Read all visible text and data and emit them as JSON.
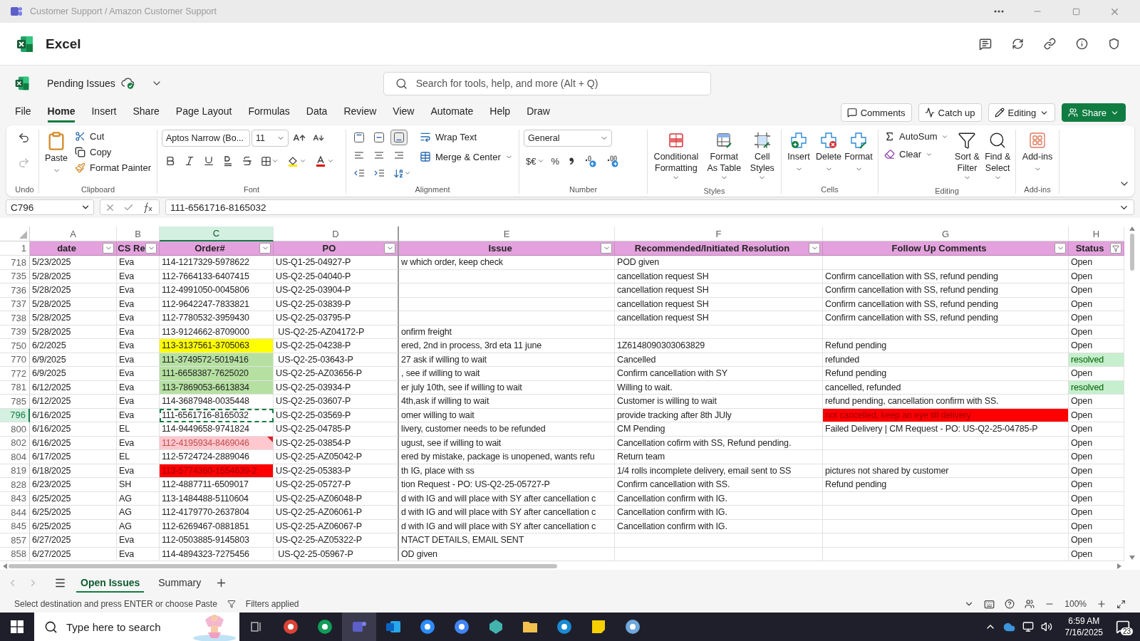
{
  "window": {
    "title": "Customer Support / Amazon Customer Support"
  },
  "app": {
    "name": "Excel"
  },
  "document": {
    "name": "Pending Issues"
  },
  "search": {
    "placeholder": "Search for tools, help, and more (Alt + Q)"
  },
  "menu_tabs": [
    {
      "label": "File",
      "selected": false
    },
    {
      "label": "Home",
      "selected": true
    },
    {
      "label": "Insert",
      "selected": false
    },
    {
      "label": "Share",
      "selected": false
    },
    {
      "label": "Page Layout",
      "selected": false
    },
    {
      "label": "Formulas",
      "selected": false
    },
    {
      "label": "Data",
      "selected": false
    },
    {
      "label": "Review",
      "selected": false
    },
    {
      "label": "View",
      "selected": false
    },
    {
      "label": "Automate",
      "selected": false
    },
    {
      "label": "Help",
      "selected": false
    },
    {
      "label": "Draw",
      "selected": false
    }
  ],
  "actions": [
    {
      "label": "Comments",
      "kind": "comments"
    },
    {
      "label": "Catch up",
      "kind": "catchup"
    },
    {
      "label": "Editing",
      "kind": "mode"
    },
    {
      "label": "Share",
      "kind": "share"
    }
  ],
  "ribbon": {
    "groups": [
      {
        "kind": "undo",
        "label": "Undo"
      },
      {
        "kind": "clipboard",
        "label": "Clipboard",
        "buttons": [
          "Paste",
          "Cut",
          "Copy",
          "Format Painter"
        ]
      },
      {
        "kind": "font",
        "label": "Font",
        "font": "Aptos Narrow (Bo...",
        "size": "11"
      },
      {
        "kind": "alignment",
        "label": "Alignment",
        "buttons": [
          "Wrap Text",
          "Merge & Center"
        ],
        "vertical": [
          {
            "selected": false
          },
          {
            "selected": false
          },
          {
            "selected": true
          }
        ]
      },
      {
        "kind": "number",
        "label": "Number",
        "format": "General",
        "currency": "$€",
        "percent": "%"
      },
      {
        "kind": "styles",
        "label": "Styles",
        "buttons": [
          "Conditional Formatting",
          "Format As Table",
          "Cell Styles"
        ]
      },
      {
        "kind": "cells",
        "label": "Cells",
        "buttons": [
          "Insert",
          "Delete",
          "Format"
        ]
      },
      {
        "kind": "editing",
        "label": "Editing",
        "buttons": [
          "AutoSum",
          "Clear",
          "Sort & Filter",
          "Find & Select"
        ]
      },
      {
        "kind": "addins",
        "label": "Add-ins",
        "buttons": [
          "Add-ins"
        ]
      }
    ]
  },
  "formula_bar": {
    "cell": "C796",
    "value": "111-6561716-8165032"
  },
  "columns": [
    {
      "letter": "A",
      "selected": false
    },
    {
      "letter": "B",
      "selected": false
    },
    {
      "letter": "C",
      "selected": true
    },
    {
      "letter": "D",
      "selected": false
    },
    {
      "letter": "E",
      "selected": false
    },
    {
      "letter": "F",
      "selected": false
    },
    {
      "letter": "G",
      "selected": false
    },
    {
      "letter": "H",
      "selected": false
    }
  ],
  "header_row": {
    "number": "1",
    "cells": [
      {
        "text": "date",
        "filtered": false
      },
      {
        "text": "CS Re",
        "filtered": false
      },
      {
        "text": "Order#",
        "filtered": false
      },
      {
        "text": "PO",
        "filtered": false
      },
      {
        "text": "Issue",
        "filtered": false
      },
      {
        "text": "Recommended/Initiated Resolution",
        "filtered": false
      },
      {
        "text": "Follow Up Comments",
        "filtered": false
      },
      {
        "text": "Status",
        "filtered": true
      }
    ]
  },
  "rows": [
    {
      "number": "718",
      "cells": [
        {
          "text": "5/23/2025"
        },
        {
          "text": "Eva"
        },
        {
          "text": "114-1217329-5978622"
        },
        {
          "text": "US-Q1-25-04927-P"
        },
        {
          "text": "w which order, keep check"
        },
        {
          "text": "POD given"
        },
        {},
        {
          "text": "Open"
        }
      ]
    },
    {
      "number": "735",
      "cells": [
        {
          "text": "5/28/2025"
        },
        {
          "text": "Eva"
        },
        {
          "text": "112-7664133-6407415"
        },
        {
          "text": "US-Q2-25-04040-P"
        },
        {},
        {
          "text": "cancellation request SH"
        },
        {
          "text": "Confirm cancellation with SS, refund pending"
        },
        {
          "text": "Open"
        }
      ]
    },
    {
      "number": "736",
      "cells": [
        {
          "text": "5/28/2025"
        },
        {
          "text": "Eva"
        },
        {
          "text": "112-4991050-0045806"
        },
        {
          "text": "US-Q2-25-03904-P"
        },
        {},
        {
          "text": "cancellation request SH"
        },
        {
          "text": "Confirm cancellation with SS, refund pending"
        },
        {
          "text": "Open"
        }
      ]
    },
    {
      "number": "737",
      "cells": [
        {
          "text": "5/28/2025"
        },
        {
          "text": "Eva"
        },
        {
          "text": "112-9642247-7833821"
        },
        {
          "text": "US-Q2-25-03839-P"
        },
        {},
        {
          "text": "cancellation request SH"
        },
        {
          "text": "Confirm cancellation with SS, refund pending"
        },
        {
          "text": "Open"
        }
      ]
    },
    {
      "number": "738",
      "cells": [
        {
          "text": "5/28/2025"
        },
        {
          "text": "Eva"
        },
        {
          "text": "112-7780532-3959430"
        },
        {
          "text": "US-Q2-25-03795-P"
        },
        {},
        {
          "text": "cancellation request SH"
        },
        {
          "text": "Confirm cancellation with SS, refund pending"
        },
        {
          "text": "Open"
        }
      ]
    },
    {
      "number": "739",
      "cells": [
        {
          "text": "5/28/2025"
        },
        {
          "text": "Eva"
        },
        {
          "text": "113-9124662-8709000"
        },
        {
          "text": " US-Q2-25-AZ04172-P"
        },
        {
          "text": "onfirm freight"
        },
        {},
        {},
        {
          "text": "Open"
        }
      ]
    },
    {
      "number": "750",
      "cells": [
        {
          "text": "6/2/2025"
        },
        {
          "text": "Eva"
        },
        {
          "text": "113-3137561-3705063",
          "color": "#ffff00"
        },
        {
          "text": "US-Q2-25-04238-P"
        },
        {
          "text": "ered, 2nd in process, 3rd eta 11 june"
        },
        {
          "text": "1Z6148090303063829"
        },
        {
          "text": "Refund pending"
        },
        {
          "text": "Open"
        }
      ]
    },
    {
      "number": "770",
      "cells": [
        {
          "text": "6/9/2025"
        },
        {
          "text": "Eva"
        },
        {
          "text": "111-3749572-5019416",
          "color": "#b5e0a1"
        },
        {
          "text": " US-Q2-25-03643-P"
        },
        {
          "text": "27 ask if willing to wait"
        },
        {
          "text": "Cancelled"
        },
        {
          "text": "refunded"
        },
        {
          "text": "resolved",
          "color": "#c6efce",
          "kind": "good"
        }
      ]
    },
    {
      "number": "772",
      "cells": [
        {
          "text": "6/9/2025"
        },
        {
          "text": "Eva"
        },
        {
          "text": "111-6658387-7625020",
          "color": "#b5e0a1"
        },
        {
          "text": "US-Q2-25-AZ03656-P"
        },
        {
          "text": ", see if willing to wait"
        },
        {
          "text": "Confirm cancellation with SY"
        },
        {
          "text": "Refund pending"
        },
        {
          "text": "Open"
        }
      ]
    },
    {
      "number": "781",
      "cells": [
        {
          "text": "6/12/2025"
        },
        {
          "text": "Eva"
        },
        {
          "text": "113-7869053-6613834",
          "color": "#b5e0a1"
        },
        {
          "text": "US-Q2-25-03934-P"
        },
        {
          "text": "er july 10th, see if willing to wait"
        },
        {
          "text": "Willing to wait."
        },
        {
          "text": "cancelled, refunded"
        },
        {
          "text": "resolved",
          "color": "#c6efce",
          "kind": "good"
        }
      ]
    },
    {
      "number": "785",
      "cells": [
        {
          "text": "6/12/2025"
        },
        {
          "text": "Eva"
        },
        {
          "text": "114-3687948-0035448"
        },
        {
          "text": "US-Q2-25-03607-P"
        },
        {
          "text": "4th,ask if willing to wait"
        },
        {
          "text": "Customer is willing to wait"
        },
        {
          "text": "refund pending, cancellation confirm with SS."
        },
        {
          "text": "Open"
        }
      ]
    },
    {
      "number": "796",
      "cells": [
        {
          "text": "6/16/2025"
        },
        {
          "text": "Eva"
        },
        {
          "text": "111-6561716-8165032",
          "selected": true
        },
        {
          "text": "US-Q2-25-03569-P"
        },
        {
          "text": "omer willing to wait"
        },
        {
          "text": "provide tracking after 8th JUly"
        },
        {
          "text": "not cancelled, keep an eye till delivery",
          "color": "#ff0000",
          "kind": "alert"
        },
        {
          "text": "Open"
        }
      ]
    },
    {
      "number": "800",
      "cells": [
        {
          "text": "6/16/2025"
        },
        {
          "text": "EL"
        },
        {
          "text": "114-9449658-9741824"
        },
        {
          "text": "US-Q2-25-04785-P"
        },
        {
          "text": "livery, customer needs to be refunded"
        },
        {
          "text": "CM Pending"
        },
        {
          "text": "Failed Delivery | CM Request - PO: US-Q2-25-04785-P"
        },
        {
          "text": "Open"
        }
      ]
    },
    {
      "number": "802",
      "cells": [
        {
          "text": "6/16/2025"
        },
        {
          "text": "Eva"
        },
        {
          "text": "112-4195934-8469046",
          "color": "#ffc7ce",
          "kind": "bad",
          "comment": true
        },
        {
          "text": "US-Q2-25-03854-P"
        },
        {
          "text": "ugust, see if willing to wait"
        },
        {
          "text": "Cancellation cofirm with SS, Refund pending."
        },
        {},
        {
          "text": "Open"
        }
      ]
    },
    {
      "number": "804",
      "cells": [
        {
          "text": "6/17/2025"
        },
        {
          "text": "EL"
        },
        {
          "text": "112-5724724-2889046"
        },
        {
          "text": "US-Q2-25-AZ05042-P"
        },
        {
          "text": "ered by mistake, package is unopened, wants refu"
        },
        {
          "text": "Return team"
        },
        {},
        {
          "text": "Open"
        }
      ]
    },
    {
      "number": "819",
      "cells": [
        {
          "text": "6/18/2025"
        },
        {
          "text": "Eva"
        },
        {
          "text": "113-5774360-1554639-2",
          "color": "#ff0000",
          "kind": "alert"
        },
        {
          "text": "US-Q2-25-05383-P"
        },
        {
          "text": "th IG, place with ss"
        },
        {
          "text": "1/4 rolls incomplete delivery, email sent to SS"
        },
        {
          "text": "pictures not shared by customer"
        },
        {
          "text": "Open"
        }
      ]
    },
    {
      "number": "828",
      "cells": [
        {
          "text": "6/23/2025"
        },
        {
          "text": "SH"
        },
        {
          "text": "112-4887711-6509017"
        },
        {
          "text": "US-Q2-25-05727-P"
        },
        {
          "text": "tion Request - PO: US-Q2-25-05727-P"
        },
        {
          "text": "Confirm cancellation with SS."
        },
        {
          "text": "Refund pending"
        },
        {
          "text": "Open"
        }
      ]
    },
    {
      "number": "843",
      "cells": [
        {
          "text": "6/25/2025"
        },
        {
          "text": "AG"
        },
        {
          "text": "113-1484488-5110604"
        },
        {
          "text": "US-Q2-25-AZ06048-P"
        },
        {
          "text": "d with IG and will place with SY after cancellation c"
        },
        {
          "text": "Cancellation confirm with IG."
        },
        {},
        {
          "text": "Open"
        }
      ]
    },
    {
      "number": "844",
      "cells": [
        {
          "text": "6/25/2025"
        },
        {
          "text": "AG"
        },
        {
          "text": "112-4179770-2637804"
        },
        {
          "text": "US-Q2-25-AZ06061-P"
        },
        {
          "text": "d with IG and will place with SY after cancellation c"
        },
        {
          "text": "Cancellation confirm with IG."
        },
        {},
        {
          "text": "Open"
        }
      ]
    },
    {
      "number": "845",
      "cells": [
        {
          "text": "6/25/2025"
        },
        {
          "text": "AG"
        },
        {
          "text": "112-6269467-0881851"
        },
        {
          "text": "US-Q2-25-AZ06067-P"
        },
        {
          "text": "d with IG and will place with SY after cancellation c"
        },
        {
          "text": "Cancellation confirm with IG."
        },
        {},
        {
          "text": "Open"
        }
      ]
    },
    {
      "number": "857",
      "cells": [
        {
          "text": "6/27/2025"
        },
        {
          "text": "Eva"
        },
        {
          "text": "112-0503885-9145803"
        },
        {
          "text": "US-Q2-25-AZ05322-P"
        },
        {
          "text": "NTACT DETAILS, EMAIL SENT"
        },
        {},
        {},
        {
          "text": "Open"
        }
      ]
    },
    {
      "number": "858",
      "cells": [
        {
          "text": "6/27/2025"
        },
        {
          "text": "Eva"
        },
        {
          "text": "114-4894323-7275456"
        },
        {
          "text": " US-Q2-25-05967-P"
        },
        {
          "text": "OD given"
        },
        {},
        {},
        {
          "text": "Open"
        }
      ]
    }
  ],
  "sheet_tabs": [
    {
      "label": "Open Issues",
      "selected": true
    },
    {
      "label": "Summary",
      "selected": false
    }
  ],
  "status_bar": {
    "message": "Select destination and press ENTER or choose Paste",
    "filters": "Filters applied",
    "zoom": "100%"
  },
  "taskbar": {
    "search_placeholder": "Type here to search",
    "apps": [
      {
        "selected": false
      },
      {
        "selected": false
      },
      {
        "selected": false
      },
      {
        "selected": true
      },
      {
        "selected": false
      },
      {
        "selected": false
      },
      {
        "selected": false
      },
      {
        "selected": false
      },
      {
        "selected": false
      },
      {
        "selected": false
      },
      {
        "selected": false
      },
      {
        "selected": false
      }
    ],
    "time": "6:59 AM",
    "date": "7/16/2025",
    "notifications": "23"
  }
}
